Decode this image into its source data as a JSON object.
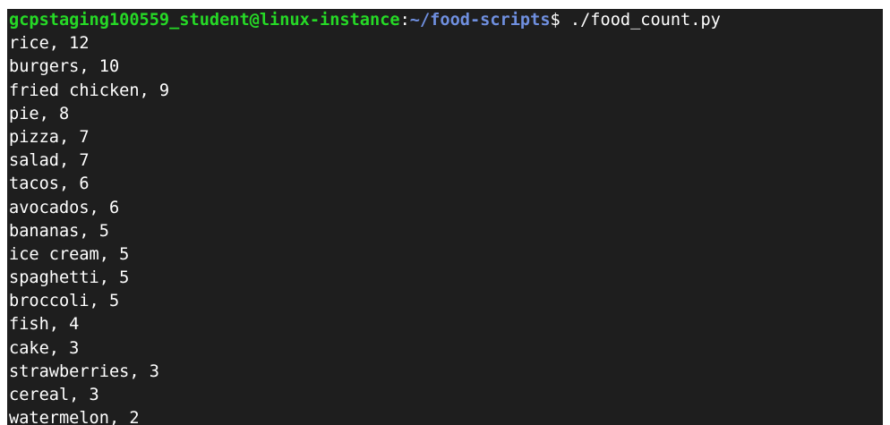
{
  "prompt": {
    "user_host": "gcpstaging100559_student@linux-instance",
    "separator": ":",
    "path": "~/food-scripts",
    "symbol": "$ ",
    "command": "./food_count.py"
  },
  "output_lines": [
    "rice, 12",
    "burgers, 10",
    "fried chicken, 9",
    "pie, 8",
    "pizza, 7",
    "salad, 7",
    "tacos, 6",
    "avocados, 6",
    "bananas, 5",
    "ice cream, 5",
    "spaghetti, 5",
    "broccoli, 5",
    "fish, 4",
    "cake, 3",
    "strawberries, 3",
    "cereal, 3",
    "watermelon, 2"
  ],
  "colors": {
    "background": "#1e1e1e",
    "text": "#ffffff",
    "user_host": "#26d926",
    "path": "#6f8fdf"
  }
}
